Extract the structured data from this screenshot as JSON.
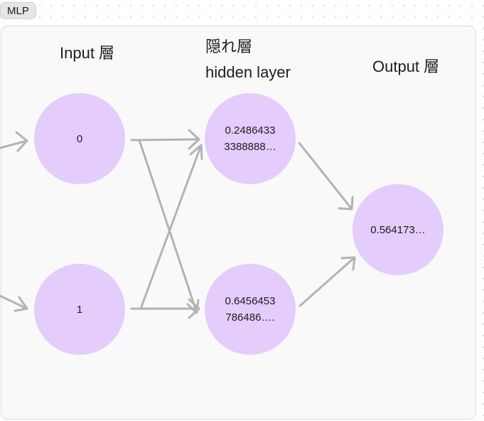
{
  "frame": {
    "tag": "MLP"
  },
  "labels": {
    "input": "Input 層",
    "hidden_ja": "隠れ層",
    "hidden_en": "hidden layer",
    "output": "Output 層"
  },
  "nodes": {
    "input_0": "0",
    "input_1": "1",
    "hidden_0": "0.2486433\n3388888…",
    "hidden_1": "0.6456453\n786486….",
    "output_0": "0.564173…"
  },
  "colors": {
    "node_fill": "#e4ccfc",
    "arrow": "#b3b3b3",
    "frame_bg": "#f9f9f9"
  }
}
